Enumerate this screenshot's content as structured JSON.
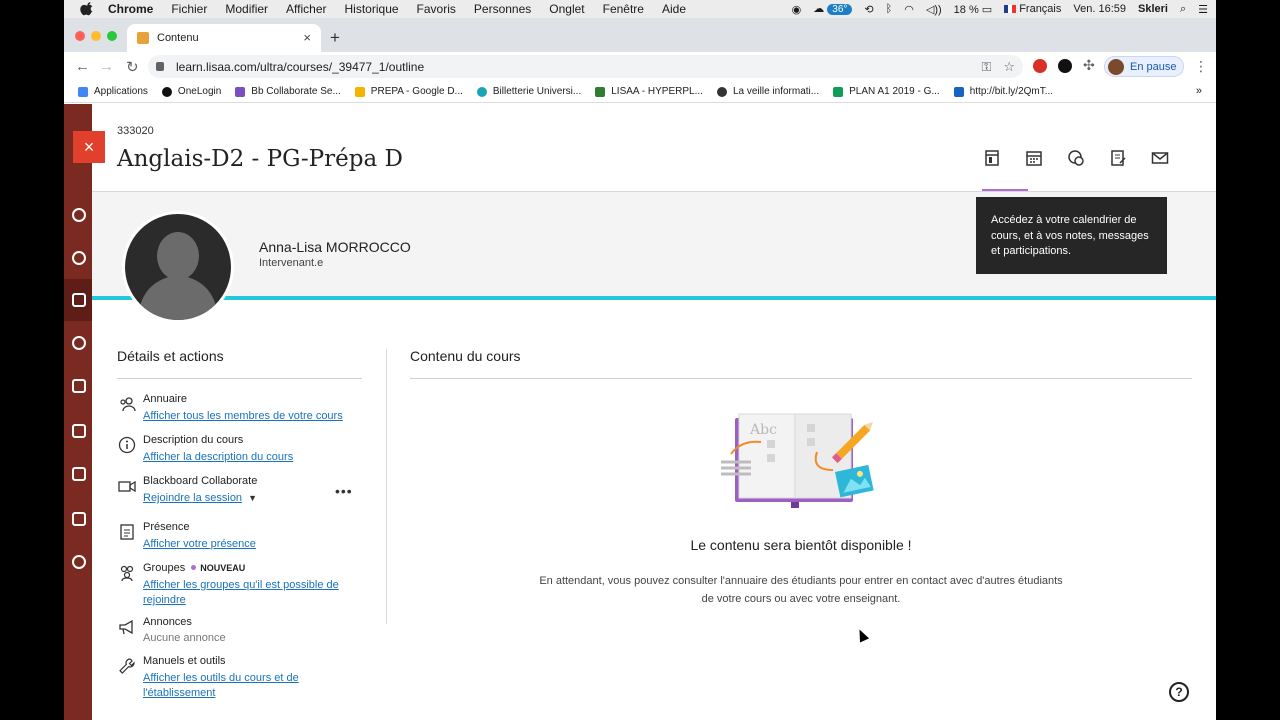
{
  "menubar": {
    "app": "Chrome",
    "items": [
      "Fichier",
      "Modifier",
      "Afficher",
      "Historique",
      "Favoris",
      "Personnes",
      "Onglet",
      "Fenêtre",
      "Aide"
    ],
    "temperature": "36°",
    "battery": "18 %",
    "language": "Français",
    "clock": "Ven. 16:59",
    "user": "Skleri"
  },
  "tab": {
    "title": "Contenu",
    "close": "×",
    "new_tab": "+"
  },
  "address": {
    "url": "learn.lisaa.com/ultra/courses/_39477_1/outline",
    "profile_label": "En pause"
  },
  "bookmarks": [
    {
      "label": "Applications",
      "color": "#4285f4"
    },
    {
      "label": "OneLogin",
      "color": "#111111"
    },
    {
      "label": "Bb Collaborate Se...",
      "color": "#7b4fc4"
    },
    {
      "label": "PREPA - Google D...",
      "color": "#f4b400"
    },
    {
      "label": "Billetterie Universi...",
      "color": "#1aa3b5"
    },
    {
      "label": "LISAA - HYPERPL...",
      "color": "#2e7d32"
    },
    {
      "label": "La veille informati...",
      "color": "#333333"
    },
    {
      "label": "PLAN A1 2019 - G...",
      "color": "#0f9d58"
    },
    {
      "label": "http://bit.ly/2QmT...",
      "color": "#1565c0"
    }
  ],
  "bookmarks_more": "»",
  "course": {
    "id": "333020",
    "title": "Anglais-D2 - PG-Prépa D",
    "close_icon": "×"
  },
  "instructor": {
    "name": "Anna-Lisa MORROCCO",
    "role": "Intervenant.e"
  },
  "tooltip": "Accédez à votre calendrier de cours, et à vos notes, messages et participations.",
  "details": {
    "title": "Détails et actions",
    "items": [
      {
        "title": "Annuaire",
        "link": "Afficher tous les membres de votre cours"
      },
      {
        "title": "Description du cours",
        "link": "Afficher la description du cours"
      },
      {
        "title": "Blackboard Collaborate",
        "link": "Rejoindre la session"
      },
      {
        "title": "Présence",
        "link": "Afficher votre présence"
      },
      {
        "title": "Groupes",
        "badge": "NOUVEAU",
        "link": "Afficher les groupes qu'il est possible de rejoindre"
      },
      {
        "title": "Annonces",
        "muted": "Aucune annonce"
      },
      {
        "title": "Manuels et outils",
        "link": "Afficher les outils du cours et de l'établissement"
      }
    ],
    "more": "•••"
  },
  "content": {
    "title": "Contenu du cours",
    "empty_title": "Le contenu sera bientôt disponible !",
    "empty_desc": "En attendant, vous pouvez consulter l'annuaire des étudiants pour entrer en contact avec d'autres étudiants de votre cours ou avec votre enseignant.",
    "illustration_text": "Abc"
  },
  "help": "?",
  "colors": {
    "accent_purple": "#b06cd1",
    "stripe_cyan": "#22c7e0",
    "rail": "#7b2a22",
    "close_red": "#e1412c",
    "link_blue": "#1a73b8"
  }
}
